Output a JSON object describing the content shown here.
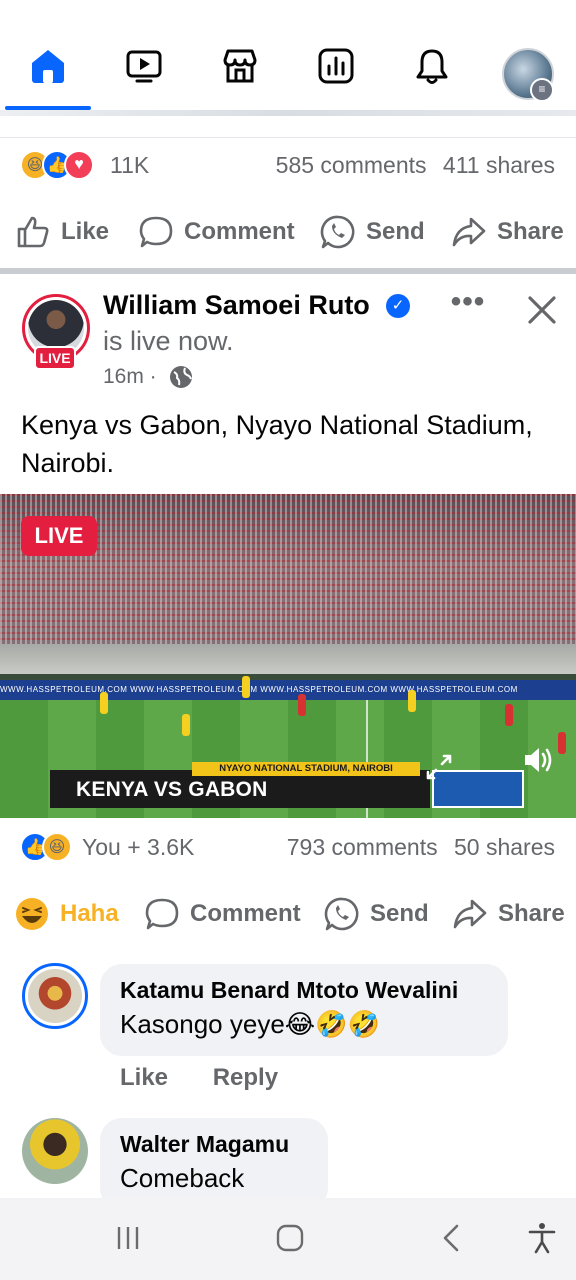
{
  "top_nav": {
    "items": [
      {
        "name": "home-icon",
        "active": true
      },
      {
        "name": "video-icon",
        "active": false
      },
      {
        "name": "marketplace-icon",
        "active": false
      },
      {
        "name": "feeds-icon",
        "active": false
      },
      {
        "name": "notifications-icon",
        "active": false
      },
      {
        "name": "profile-menu-avatar",
        "active": false
      }
    ],
    "accent_color": "#0866ff"
  },
  "prev_post": {
    "reactions_count": "11K",
    "comments": "585 comments",
    "shares": "411 shares",
    "actions": {
      "like": "Like",
      "comment": "Comment",
      "send": "Send",
      "share": "Share"
    }
  },
  "post": {
    "author": "William Samoei Ruto",
    "status": "is live now.",
    "time": "16m ·",
    "live_badge": "LIVE",
    "text": "Kenya vs Gabon, Nyayo National Stadium, Nairobi.",
    "video": {
      "live_label": "LIVE",
      "scoreboard": "KENYA VS GABON",
      "venue": "NYAYO NATIONAL STADIUM, NAIROBI",
      "adboard": "WWW.HASSPETROLEUM.COM      WWW.HASSPETROLEUM.COM      WWW.HASSPETROLEUM.COM      WWW.HASSPETROLEUM.COM"
    },
    "reactions_count": "You + 3.6K",
    "comments": "793 comments",
    "shares": "50 shares",
    "actions": {
      "reaction": "Haha",
      "comment": "Comment",
      "send": "Send",
      "share": "Share"
    },
    "live_color": "#e41e3f"
  },
  "comments": [
    {
      "name": "Katamu Benard Mtoto Wevalini",
      "text": "Kasongo yeye😂🤣🤣",
      "like": "Like",
      "reply": "Reply"
    },
    {
      "name": "Walter Magamu",
      "text": "Comeback"
    }
  ]
}
